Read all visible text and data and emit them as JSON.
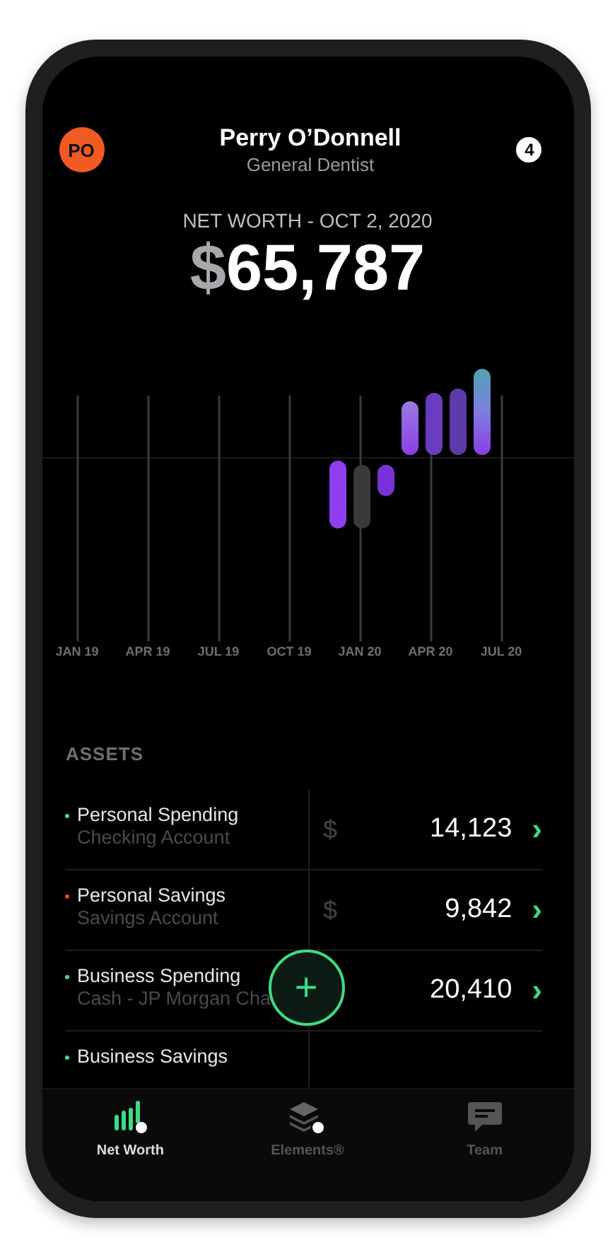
{
  "profile": {
    "initials": "PO",
    "name": "Perry O’Donnell",
    "role": "General Dentist",
    "notifications": "4"
  },
  "net_worth": {
    "label": "NET WORTH - OCT 2, 2020",
    "currency": "$",
    "amount": "65,787"
  },
  "chart": {
    "x_labels": [
      "JAN 19",
      "APR 19",
      "JUL 19",
      "OCT 19",
      "JAN 20",
      "APR 20",
      "JUL 20"
    ]
  },
  "assets": {
    "title": "ASSETS",
    "rows": [
      {
        "name": "Personal Spending",
        "account": "Checking Account",
        "currency": "$",
        "amount": "14,123",
        "chevron": "›",
        "color": "#3ddc84"
      },
      {
        "name": "Personal Savings",
        "account": "Savings Account",
        "currency": "$",
        "amount": "9,842",
        "chevron": "›",
        "color": "#e0452b"
      },
      {
        "name": "Business Spending",
        "account": "Cash - JP Morgan Cha",
        "amount": "20,410",
        "chevron": "›",
        "color": "#3ddc84"
      },
      {
        "name": "Business Savings",
        "color": "#3ddc84"
      }
    ]
  },
  "add_button": "+",
  "tabs": [
    {
      "label": "Net Worth",
      "kind": "bars",
      "selected": true
    },
    {
      "label": "Elements®",
      "kind": "layers",
      "selected": false
    },
    {
      "label": "Team",
      "kind": "chat",
      "selected": false
    }
  ]
}
